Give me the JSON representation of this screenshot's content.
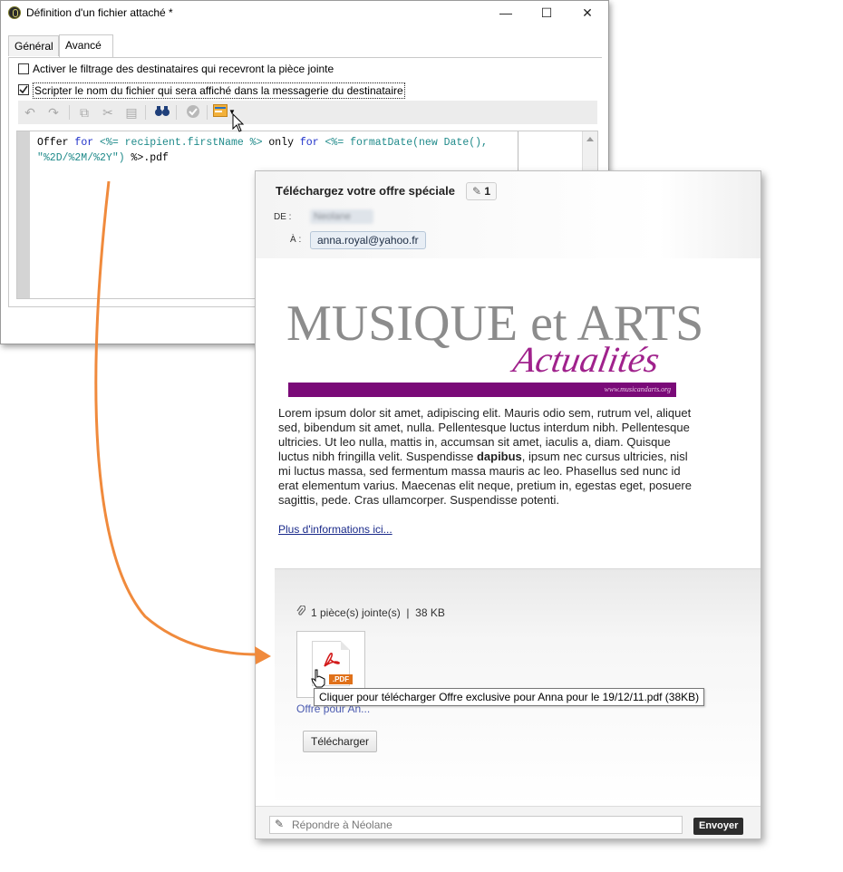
{
  "dialog": {
    "title": "Définition d'un fichier attaché *",
    "window_controls": {
      "minimize": "—",
      "maximize": "☐",
      "close": "✕"
    },
    "tabs": [
      {
        "label": "Général"
      },
      {
        "label": "Avancé",
        "active": true
      }
    ],
    "checkbox_filter": {
      "label": "Activer le filtrage des destinataires qui recevront la pièce jointe",
      "checked": false
    },
    "checkbox_script": {
      "label": "Scripter le nom du fichier qui sera affiché dans la messagerie du destinataire",
      "checked": true
    },
    "toolbar_icons": [
      "undo-icon",
      "redo-icon",
      "copy-icon",
      "cut-icon",
      "paste-icon",
      "binoculars-icon",
      "check-icon",
      "personalization-icon",
      "dropdown-icon"
    ],
    "code": {
      "line1_part1": "Offer ",
      "line1_kw1": "for",
      "line1_part2": " <%= recipient.firstName %> ",
      "line1_part3": "only ",
      "line1_kw2": "for",
      "line1_part4": " <%= formatDate(new Date(),",
      "line2_str": "\"%2D/%2M/%2Y\")",
      "line2_rest": " %>.pdf"
    }
  },
  "mail": {
    "subject": "Téléchargez votre offre spéciale",
    "attachment_count": "1",
    "from_label": "DE :",
    "from_value": "Neolane",
    "to_label": "À :",
    "to_value": "anna.royal@yahoo.fr",
    "banner": {
      "title": "MUSIQUE et ARTS",
      "script": "Actualités",
      "url": "www.musicandarts.org"
    },
    "body_part1": "Lorem ipsum dolor sit amet, adipiscing elit. Mauris odio sem, rutrum vel, aliquet sed, bibendum sit amet, nulla. Pellentesque luctus interdum nibh. Pellentesque ultricies. Ut leo nulla, mattis in, accumsan sit amet, iaculis a, diam. Quisque luctus nibh fringilla velit. Suspendisse ",
    "body_bold": "dapibus",
    "body_part2": ", ipsum nec cursus ultricies, nisl mi luctus massa, sed fermentum massa mauris ac leo. Phasellus sed nunc id erat elementum varius. Maecenas elit neque, pretium in, egestas eget, posuere sagittis, pede. Cras ullamcorper. Suspendisse potenti.",
    "more_link": "Plus d'informations ici...",
    "attachments": {
      "summary": "1 pièce(s) jointe(s)",
      "separator": "|",
      "size": "38 KB",
      "pdf_tag": ".PDF",
      "file_name": "Offre pour An...",
      "tooltip": "Cliquer pour télécharger Offre exclusive pour Anna pour le 19/12/11.pdf (38KB)",
      "download_label": "Télécharger"
    },
    "reply_placeholder": "Répondre à Néolane",
    "send_label": "Envoyer"
  },
  "colors": {
    "arrow": "#f08a3c",
    "banner_purple": "#7a0a78",
    "script_pink": "#a0228c"
  }
}
